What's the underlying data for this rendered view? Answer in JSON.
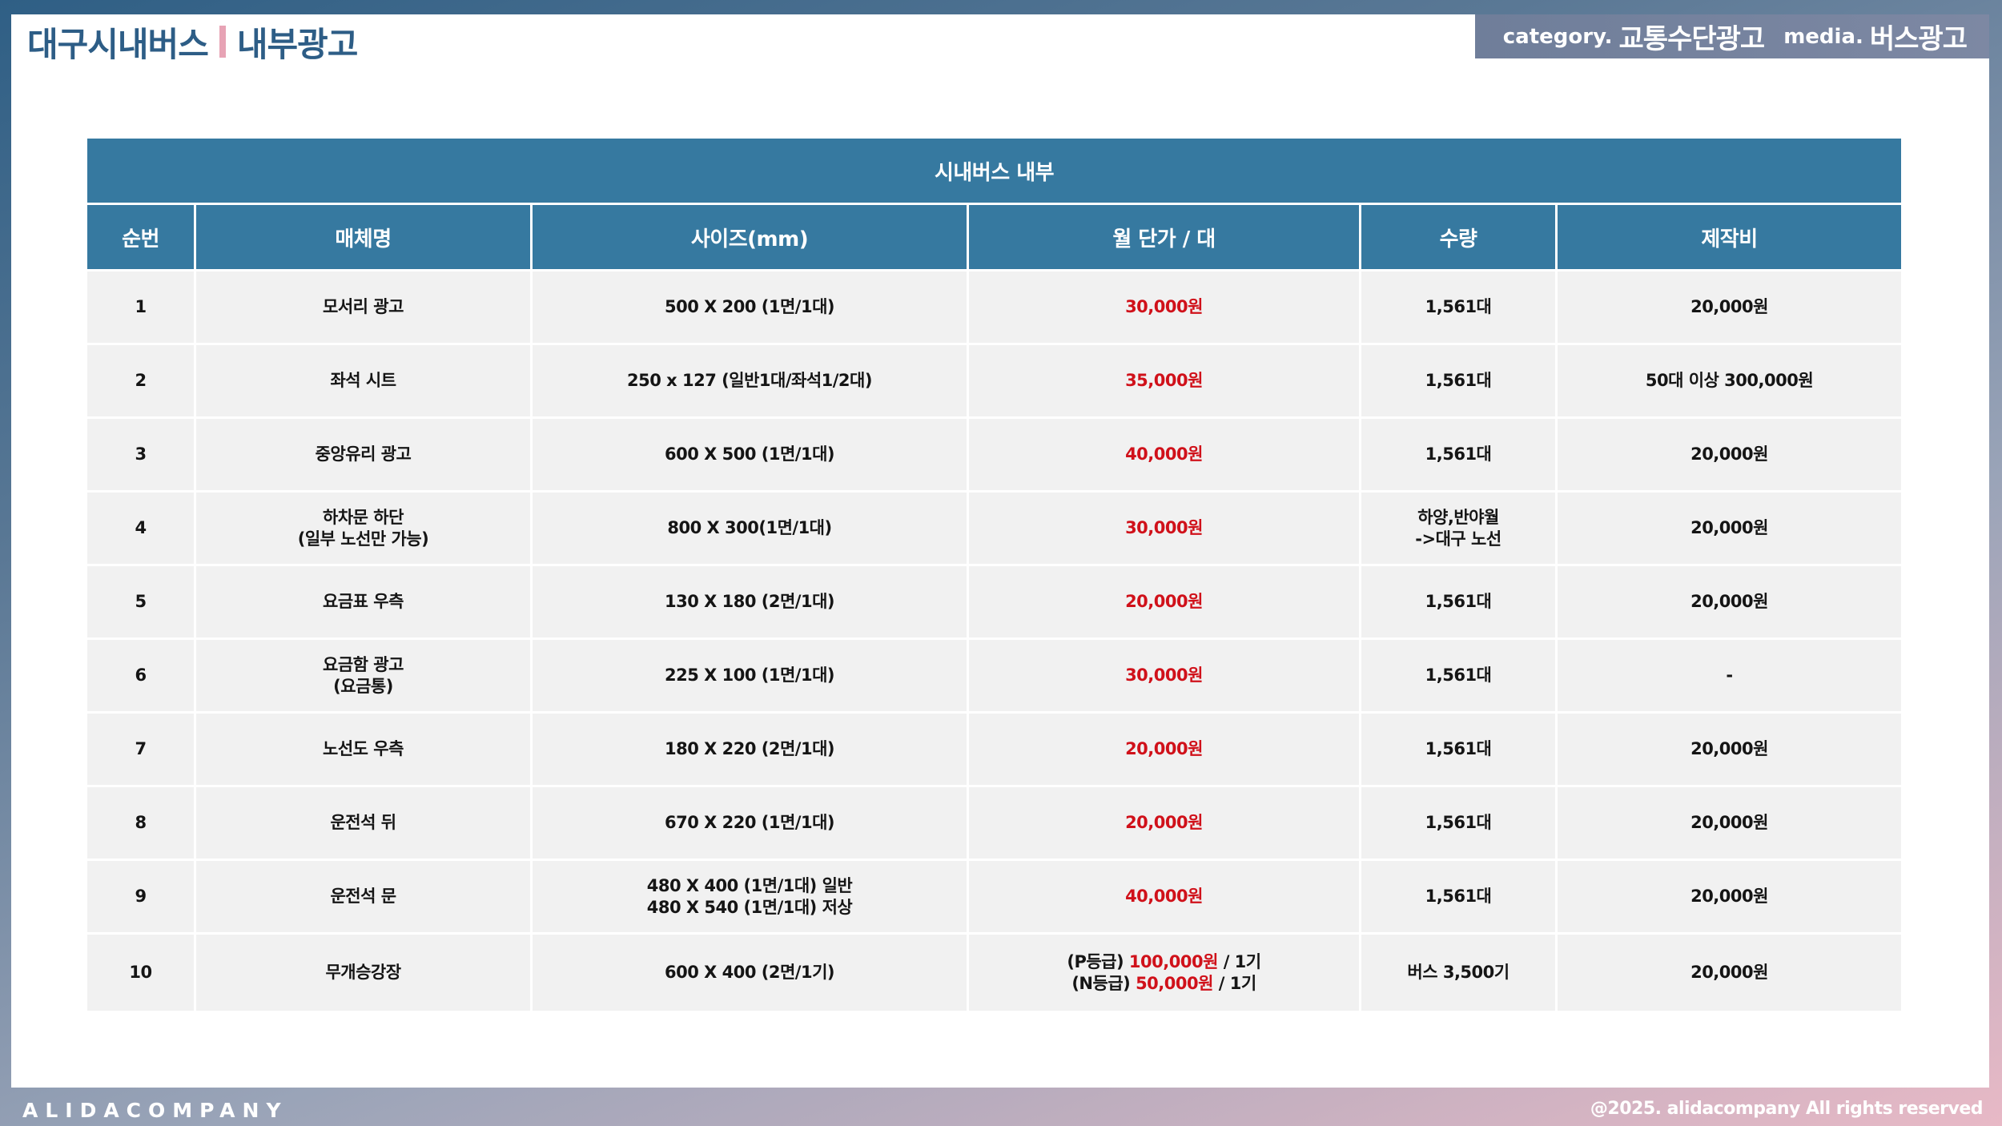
{
  "header": {
    "title_left": "대구시내버스",
    "title_right": "내부광고",
    "category_label": "category.",
    "category_value": "교통수단광고",
    "media_label": "media.",
    "media_value": "버스광고"
  },
  "table": {
    "caption": "시내버스 내부",
    "columns": [
      "순번",
      "매체명",
      "사이즈(mm)",
      "월 단가 / 대",
      "수량",
      "제작비"
    ],
    "rows": [
      {
        "no": "1",
        "name1": "모서리 광고",
        "name2": "",
        "size1": "500 X 200 (1면/1대)",
        "size2": "",
        "price": "30,000원",
        "qty1": "1,561대",
        "qty2": "",
        "cost": "20,000원"
      },
      {
        "no": "2",
        "name1": "좌석 시트",
        "name2": "",
        "size1": "250  x 127 (일반1대/좌석1/2대)",
        "size2": "",
        "price": "35,000원",
        "qty1": "1,561대",
        "qty2": "",
        "cost": "50대 이상 300,000원"
      },
      {
        "no": "3",
        "name1": "중앙유리 광고",
        "name2": "",
        "size1": "600 X 500 (1면/1대)",
        "size2": "",
        "price": "40,000원",
        "qty1": "1,561대",
        "qty2": "",
        "cost": "20,000원"
      },
      {
        "no": "4",
        "name1": "하차문 하단",
        "name2": "(일부 노선만 가능)",
        "size1": "800 X 300(1면/1대)",
        "size2": "",
        "price": "30,000원",
        "qty1": "하양,반야월",
        "qty2": "->대구 노선",
        "cost": "20,000원"
      },
      {
        "no": "5",
        "name1": "요금표 우측",
        "name2": "",
        "size1": "130 X 180 (2면/1대)",
        "size2": "",
        "price": "20,000원",
        "qty1": "1,561대",
        "qty2": "",
        "cost": "20,000원"
      },
      {
        "no": "6",
        "name1": "요금함 광고",
        "name2": "(요금통)",
        "size1": "225 X 100 (1면/1대)",
        "size2": "",
        "price": "30,000원",
        "qty1": "1,561대",
        "qty2": "",
        "cost": "-"
      },
      {
        "no": "7",
        "name1": "노선도 우측",
        "name2": "",
        "size1": "180 X 220 (2면/1대)",
        "size2": "",
        "price": "20,000원",
        "qty1": "1,561대",
        "qty2": "",
        "cost": "20,000원"
      },
      {
        "no": "8",
        "name1": "운전석 뒤",
        "name2": "",
        "size1": "670 X 220 (1면/1대)",
        "size2": "",
        "price": "20,000원",
        "qty1": "1,561대",
        "qty2": "",
        "cost": "20,000원"
      },
      {
        "no": "9",
        "name1": "운전석 문",
        "name2": "",
        "size1": "480 X 400 (1면/1대) 일반",
        "size2": "480 X 540 (1면/1대) 저상",
        "price": "40,000원",
        "qty1": "1,561대",
        "qty2": "",
        "cost": "20,000원"
      }
    ],
    "row10": {
      "no": "10",
      "name": "무개승강장",
      "size": "600 X 400 (2면/1기)",
      "price_p_label": "(P등급)",
      "price_p_value": "100,000원",
      "price_p_unit": "/ 1기",
      "price_n_label": "(N등급)",
      "price_n_value": "50,000원",
      "price_n_unit": "/ 1기",
      "qty": "버스 3,500기",
      "cost": "20,000원"
    }
  },
  "footer": {
    "brand": "ALIDACOMPANY",
    "copyright": "@2025. alidacompany All rights reserved"
  },
  "colors": {
    "header_blue": "#3679a0",
    "title_blue": "#2d5d86",
    "accent_pink": "#e7a3b5",
    "price_red": "#d0111a",
    "cell_gray": "#f1f1f1"
  }
}
